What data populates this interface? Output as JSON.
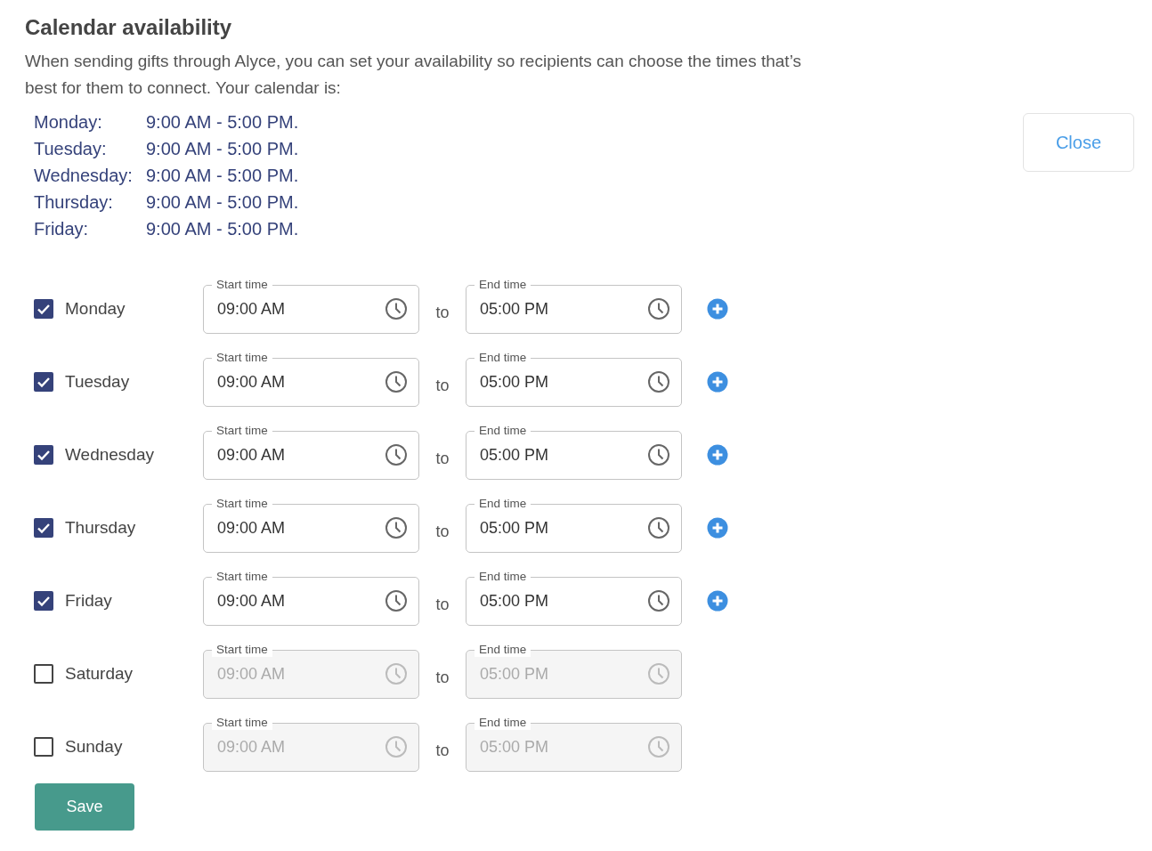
{
  "title": "Calendar availability",
  "intro": "When sending gifts through Alyce, you can set your availability so recipients can choose the times that’s best for them to connect. Your calendar is:",
  "summary": [
    {
      "day": "Monday:",
      "hours": "9:00 AM - 5:00 PM."
    },
    {
      "day": "Tuesday:",
      "hours": "9:00 AM - 5:00 PM."
    },
    {
      "day": "Wednesday:",
      "hours": "9:00 AM - 5:00 PM."
    },
    {
      "day": "Thursday:",
      "hours": "9:00 AM - 5:00 PM."
    },
    {
      "day": "Friday:",
      "hours": "9:00 AM - 5:00 PM."
    }
  ],
  "close_button": "Close",
  "days": [
    {
      "label": "Monday",
      "checked": true,
      "start": {
        "label": "Start time",
        "value": "09:00 AM"
      },
      "separator": "to",
      "end": {
        "label": "End time",
        "value": "05:00 PM"
      }
    },
    {
      "label": "Tuesday",
      "checked": true,
      "start": {
        "label": "Start time",
        "value": "09:00 AM"
      },
      "separator": "to",
      "end": {
        "label": "End time",
        "value": "05:00 PM"
      }
    },
    {
      "label": "Wednesday",
      "checked": true,
      "start": {
        "label": "Start time",
        "value": "09:00 AM"
      },
      "separator": "to",
      "end": {
        "label": "End time",
        "value": "05:00 PM"
      }
    },
    {
      "label": "Thursday",
      "checked": true,
      "start": {
        "label": "Start time",
        "value": "09:00 AM"
      },
      "separator": "to",
      "end": {
        "label": "End time",
        "value": "05:00 PM"
      }
    },
    {
      "label": "Friday",
      "checked": true,
      "start": {
        "label": "Start time",
        "value": "09:00 AM"
      },
      "separator": "to",
      "end": {
        "label": "End time",
        "value": "05:00 PM"
      }
    },
    {
      "label": "Saturday",
      "checked": false,
      "start": {
        "label": "Start time",
        "value": "09:00 AM"
      },
      "separator": "to",
      "end": {
        "label": "End time",
        "value": "05:00 PM"
      }
    },
    {
      "label": "Sunday",
      "checked": false,
      "start": {
        "label": "Start time",
        "value": "09:00 AM"
      },
      "separator": "to",
      "end": {
        "label": "End time",
        "value": "05:00 PM"
      }
    }
  ],
  "save_button": "Save"
}
